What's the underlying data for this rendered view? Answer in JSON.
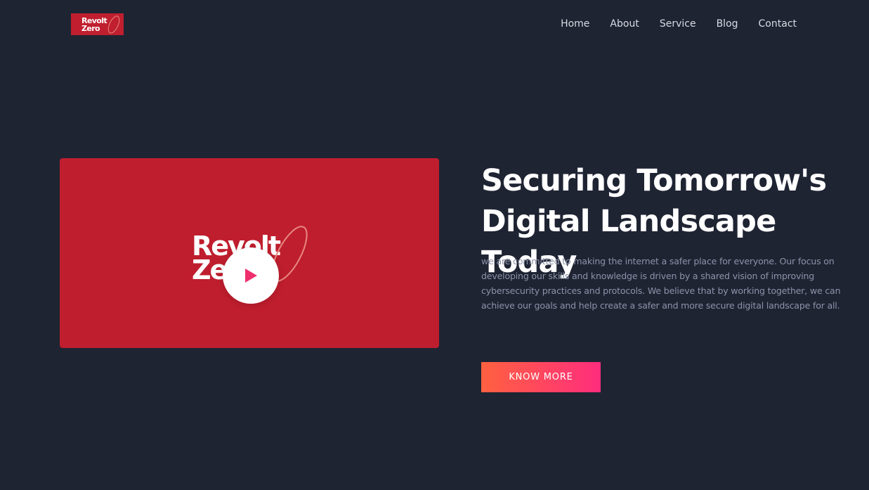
{
  "brand": {
    "line1": "Revolt",
    "line2": "Zero",
    "color": "#c01f2f"
  },
  "nav": {
    "items": [
      {
        "label": "Home"
      },
      {
        "label": "About"
      },
      {
        "label": "Service"
      },
      {
        "label": "Blog"
      },
      {
        "label": "Contact"
      }
    ]
  },
  "hero": {
    "video": {
      "brand_line1": "Revolt",
      "brand_line2": "Zero",
      "play_icon": "play-icon",
      "background": "#bf1e2e"
    },
    "headline_line1": "Securing Tomorrow's",
    "headline_line2": "Digital Landscape Today",
    "description": "we are committed to making the internet a safer place for everyone. Our focus on developing our skills and knowledge is driven by a shared vision of improving cybersecurity practices and protocols. We believe that by working together, we can achieve our goals and help create a safer and more secure digital landscape for all.",
    "cta_label": "KNOW MORE",
    "cta_gradient": [
      "#ff6140",
      "#ff2d7d"
    ]
  },
  "colors": {
    "background": "#1f2433",
    "nav_text": "#d8dbe4",
    "description_text": "#8c93a8"
  }
}
